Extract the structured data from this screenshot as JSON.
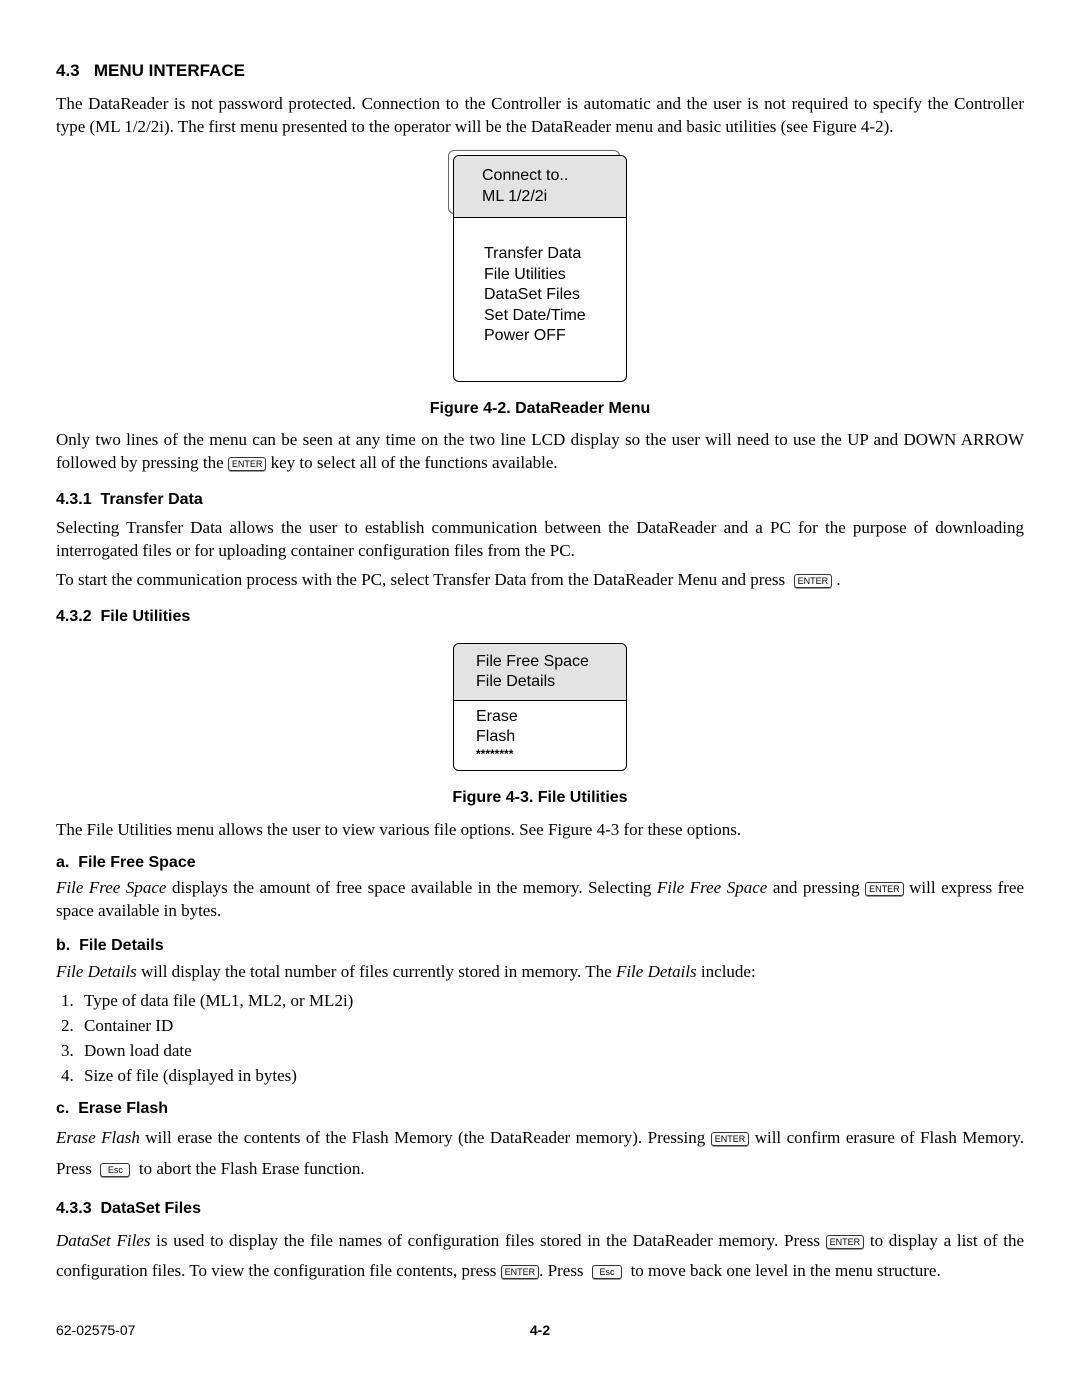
{
  "section43": {
    "num": "4.3",
    "title": "MENU INTERFACE",
    "intro": "The DataReader is not password protected. Connection to the Controller is automatic and the user is not required to specify the Controller type (ML 1/2/2i). The first menu presented to the operator will be the DataReader menu and basic utilities (see Figure 4-2)."
  },
  "fig42": {
    "header_l1": "Connect to..",
    "header_l2": "ML 1/2/2i",
    "items": [
      "Transfer Data",
      "File Utilities",
      "DataSet Files",
      "Set Date/Time",
      "Power OFF"
    ],
    "caption": "Figure 4-2. DataReader Menu"
  },
  "para_after_fig42_a": "Only two lines of the menu can be seen at any time on the two line LCD display so the user will need to use the UP and DOWN ARROW followed by pressing the ",
  "para_after_fig42_b": " key to select all of the functions available.",
  "key_enter": "ENTER",
  "key_esc": "Esc",
  "sec431": {
    "num": "4.3.1",
    "title": "Transfer Data",
    "p1": "Selecting Transfer Data allows the user to establish communication between the DataReader and a PC for the purpose of downloading interrogated files or for uploading container configuration files from the PC.",
    "p2a": "To start the communication process with the PC, select Transfer Data from the DataReader Menu and press ",
    "p2b": " ."
  },
  "sec432": {
    "num": "4.3.2",
    "title": "File Utilities"
  },
  "fig43": {
    "header_l1": "File Free Space",
    "header_l2": "File Details",
    "body_l1": "Erase",
    "body_l2": "Flash",
    "body_l3": "********",
    "caption": "Figure 4-3. File Utilities"
  },
  "para_after_fig43": "The File Utilities menu allows the user to view various file options. See Figure 4-3 for these options.",
  "sub_a": {
    "label": "a.",
    "title": "File Free Space",
    "p_a": "File Free Space",
    "p_b": " displays the amount of free space available in the memory. Selecting ",
    "p_c": "File Free Space",
    "p_d": " and pressing ",
    "p_e": " will express free space available in bytes."
  },
  "sub_b": {
    "label": "b.",
    "title": "File Details",
    "p_a": "File Details",
    "p_b": " will display the total number of files currently stored in memory. The ",
    "p_c": "File Details",
    "p_d": " include:",
    "items": [
      "Type of data file (ML1, ML2, or ML2i)",
      "Container ID",
      "Down load date",
      "Size of file (displayed in bytes)"
    ]
  },
  "sub_c": {
    "label": "c.",
    "title": "Erase Flash",
    "p_a": "Erase Flash",
    "p_b": " will erase the contents of the Flash Memory (the DataReader memory). Pressing ",
    "p_c": " will confirm erasure of Flash Memory. Press ",
    "p_d": " to abort the Flash Erase function."
  },
  "sec433": {
    "num": "4.3.3",
    "title": "DataSet Files",
    "p_a": "DataSet Files",
    "p_b": " is used to display the file names of configuration files stored in the DataReader memory. Press ",
    "p_c": " to display a list of the configuration files. To view the configuration file contents, press ",
    "p_d": ". Press ",
    "p_e": " to move back one level in the menu structure."
  },
  "footer": {
    "left": "62-02575-07",
    "mid": "4-2"
  }
}
